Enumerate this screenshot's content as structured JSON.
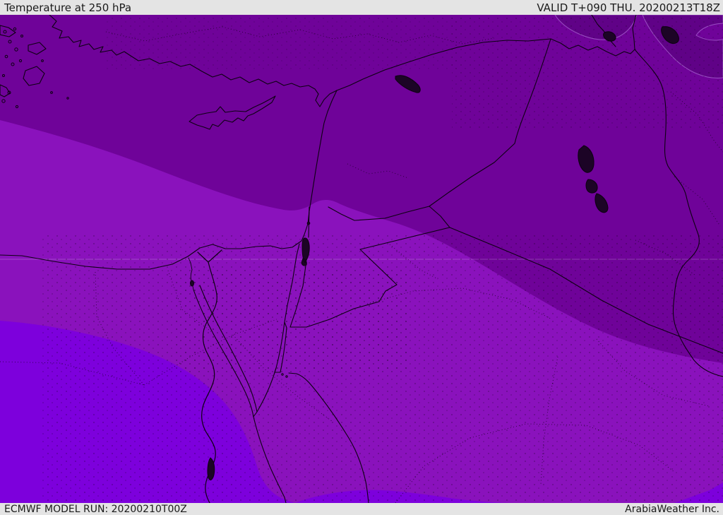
{
  "header": {
    "title": "Temperature at 250 hPa",
    "valid_label": "VALID T+090 THU. 20200213T18Z"
  },
  "footer": {
    "model_run": "ECMWF MODEL RUN: 20200210T00Z",
    "credit": "ArabiaWeather Inc."
  },
  "map": {
    "description": "ECMWF filled-contour temperature map at 250 hPa over the Middle East (Turkey, Cyprus, Levant, Egypt, Iraq, Saudi Arabia)",
    "colors": {
      "bar_bg": "#e4e4e4",
      "bar_text": "#1a1a1a",
      "band_darker": "#600287",
      "band_dark": "#6f0399",
      "band_medium": "#8a12bc",
      "band_bright": "#7d00dc",
      "border_line": "#0d0112",
      "lake_fill": "#1c0426",
      "contour_light": "#c9a0e8"
    },
    "bands": [
      {
        "name": "coldest-patches",
        "color": "#600287",
        "areas": "small blobs along top-right edge (E Turkey / NW Iran)"
      },
      {
        "name": "very-cold-band",
        "color": "#6f0399",
        "areas": "north half: Turkey, Syria, N Iraq, plus SE wedge toward Persian Gulf"
      },
      {
        "name": "cold-band",
        "color": "#8a12bc",
        "areas": "central band: E Mediterranean, Levant, Jordan, N Egypt, most of Saudi Arabia"
      },
      {
        "name": "mild-band",
        "color": "#7d00dc",
        "areas": "SW Egypt lobe, south strip and bottom-right corner"
      }
    ]
  }
}
